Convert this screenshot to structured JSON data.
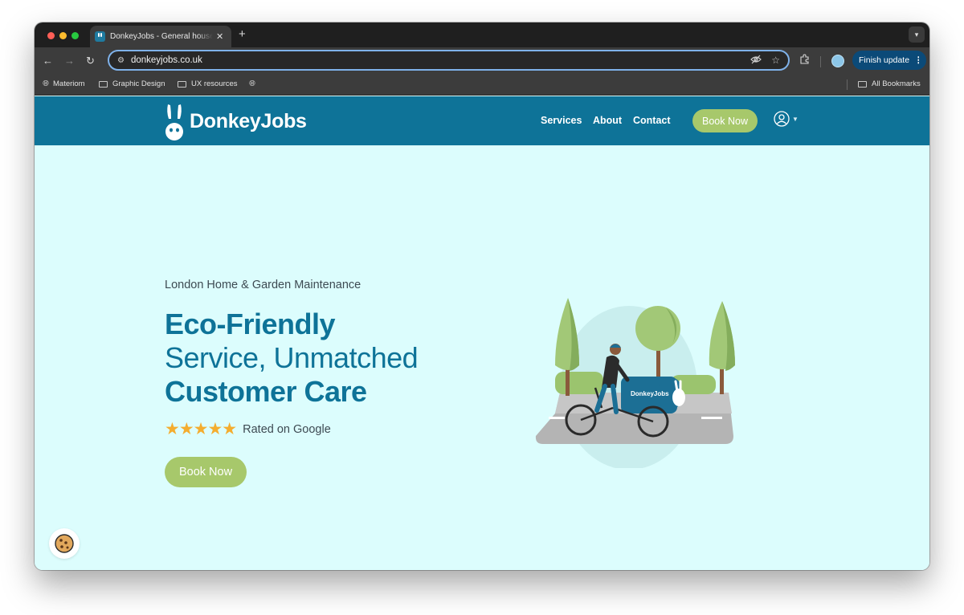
{
  "browser": {
    "tab_title": "DonkeyJobs - General household services",
    "tab_close": "✕",
    "new_tab": "+",
    "url": "donkeyjobs.co.uk",
    "finish_update": "Finish update",
    "menu_dots": "⋮",
    "bookmarks": [
      "Materiom",
      "Graphic Design",
      "UX resources"
    ],
    "all_bookmarks": "All Bookmarks"
  },
  "header": {
    "brand": "DonkeyJobs",
    "nav": [
      "Services",
      "About",
      "Contact"
    ],
    "book_now": "Book Now"
  },
  "hero": {
    "subtitle": "London Home & Garden Maintenance",
    "headline_1": "Eco-Friendly",
    "headline_2": "Service, Unmatched",
    "headline_3": "Customer Care",
    "stars": "★★★★★",
    "rating_text": "Rated on Google",
    "book_now": "Book Now",
    "cart_label": "DonkeyJobs"
  },
  "colors": {
    "brand_blue": "#0e7398",
    "hero_bg": "#dcfdfd",
    "button_green": "#a7c86b",
    "star_orange": "#f4ad2f"
  },
  "icons": [
    "back-arrow-icon",
    "forward-arrow-icon",
    "reload-icon",
    "site-settings-icon",
    "eye-off-icon",
    "star-icon",
    "extensions-icon",
    "globe-icon",
    "folder-icon",
    "account-icon",
    "cookie-icon"
  ]
}
